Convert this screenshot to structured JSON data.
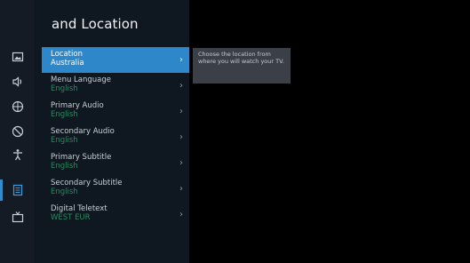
{
  "header": {
    "title": "and Location"
  },
  "menu": {
    "items": [
      {
        "label": "Location",
        "value": "Australia",
        "active": true
      },
      {
        "label": "Menu Language",
        "value": "English"
      },
      {
        "label": "Primary Audio",
        "value": "English"
      },
      {
        "label": "Secondary Audio",
        "value": "English"
      },
      {
        "label": "Primary Subtitle",
        "value": "English"
      },
      {
        "label": "Secondary Subtitle",
        "value": "English"
      },
      {
        "label": "Digital Teletext",
        "value": "WEST EUR"
      }
    ]
  },
  "tooltip": {
    "text": "Choose the location from where you will watch your TV."
  },
  "sidebar": {
    "icons": [
      "picture-icon",
      "sound-icon",
      "network-icon",
      "parental-icon",
      "accessibility-icon",
      "system-icon",
      "channels-icon"
    ],
    "active_index": 5
  },
  "colors": {
    "accent": "#2d87c8",
    "value_green": "#2a8a62"
  }
}
